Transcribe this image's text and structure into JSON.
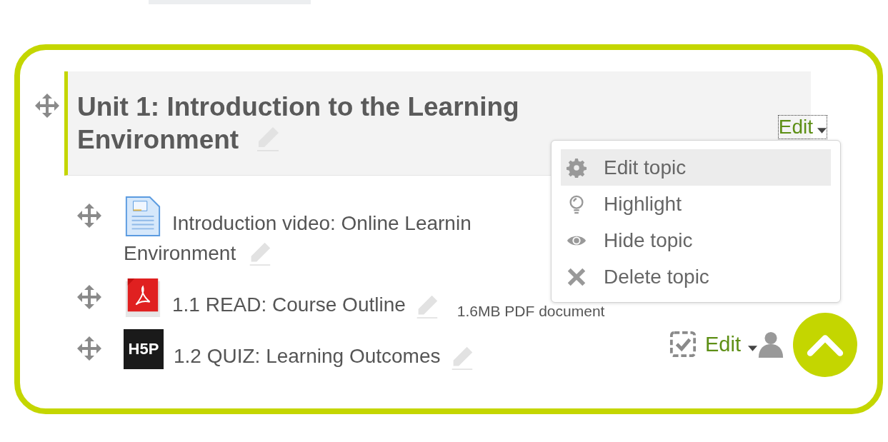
{
  "section": {
    "title": "Unit 1: Introduction to the Learning Environment",
    "edit_label": "Edit"
  },
  "menu": [
    {
      "kind": "gear",
      "label": "Edit topic",
      "selected": true
    },
    {
      "kind": "bulb",
      "label": "Highlight",
      "selected": false
    },
    {
      "kind": "eye",
      "label": "Hide topic",
      "selected": false
    },
    {
      "kind": "cross",
      "label": "Delete topic",
      "selected": false
    }
  ],
  "activities": [
    {
      "kind": "document",
      "title_lines": [
        "Introduction video: Online Learnin",
        "Environment"
      ]
    },
    {
      "kind": "pdf",
      "title_lines": [
        "1.1 READ: Course Outline"
      ],
      "info": "1.6MB PDF document"
    },
    {
      "kind": "h5p",
      "logo_text": "H5P",
      "title_lines": [
        "1.2 QUIZ: Learning Outcomes"
      ],
      "edit_label": "Edit"
    }
  ]
}
